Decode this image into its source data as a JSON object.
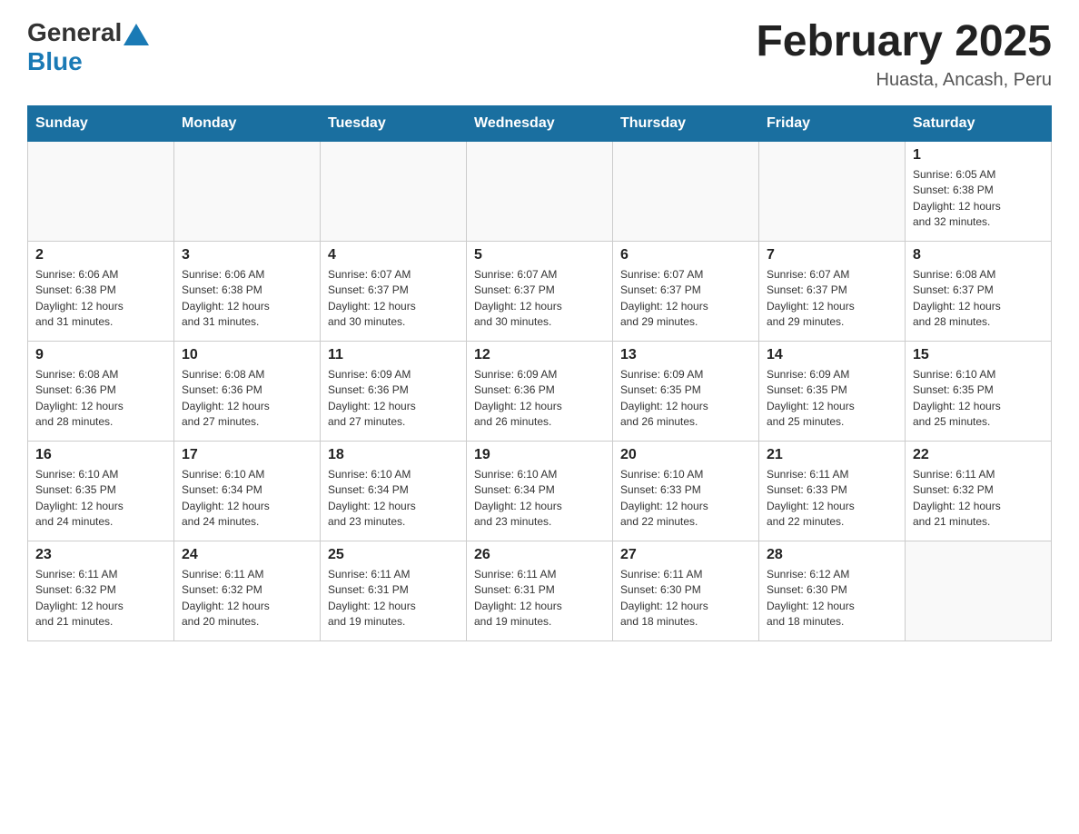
{
  "header": {
    "logo_general": "General",
    "logo_blue": "Blue",
    "title": "February 2025",
    "subtitle": "Huasta, Ancash, Peru"
  },
  "weekdays": [
    "Sunday",
    "Monday",
    "Tuesday",
    "Wednesday",
    "Thursday",
    "Friday",
    "Saturday"
  ],
  "weeks": [
    [
      {
        "day": "",
        "info": ""
      },
      {
        "day": "",
        "info": ""
      },
      {
        "day": "",
        "info": ""
      },
      {
        "day": "",
        "info": ""
      },
      {
        "day": "",
        "info": ""
      },
      {
        "day": "",
        "info": ""
      },
      {
        "day": "1",
        "info": "Sunrise: 6:05 AM\nSunset: 6:38 PM\nDaylight: 12 hours\nand 32 minutes."
      }
    ],
    [
      {
        "day": "2",
        "info": "Sunrise: 6:06 AM\nSunset: 6:38 PM\nDaylight: 12 hours\nand 31 minutes."
      },
      {
        "day": "3",
        "info": "Sunrise: 6:06 AM\nSunset: 6:38 PM\nDaylight: 12 hours\nand 31 minutes."
      },
      {
        "day": "4",
        "info": "Sunrise: 6:07 AM\nSunset: 6:37 PM\nDaylight: 12 hours\nand 30 minutes."
      },
      {
        "day": "5",
        "info": "Sunrise: 6:07 AM\nSunset: 6:37 PM\nDaylight: 12 hours\nand 30 minutes."
      },
      {
        "day": "6",
        "info": "Sunrise: 6:07 AM\nSunset: 6:37 PM\nDaylight: 12 hours\nand 29 minutes."
      },
      {
        "day": "7",
        "info": "Sunrise: 6:07 AM\nSunset: 6:37 PM\nDaylight: 12 hours\nand 29 minutes."
      },
      {
        "day": "8",
        "info": "Sunrise: 6:08 AM\nSunset: 6:37 PM\nDaylight: 12 hours\nand 28 minutes."
      }
    ],
    [
      {
        "day": "9",
        "info": "Sunrise: 6:08 AM\nSunset: 6:36 PM\nDaylight: 12 hours\nand 28 minutes."
      },
      {
        "day": "10",
        "info": "Sunrise: 6:08 AM\nSunset: 6:36 PM\nDaylight: 12 hours\nand 27 minutes."
      },
      {
        "day": "11",
        "info": "Sunrise: 6:09 AM\nSunset: 6:36 PM\nDaylight: 12 hours\nand 27 minutes."
      },
      {
        "day": "12",
        "info": "Sunrise: 6:09 AM\nSunset: 6:36 PM\nDaylight: 12 hours\nand 26 minutes."
      },
      {
        "day": "13",
        "info": "Sunrise: 6:09 AM\nSunset: 6:35 PM\nDaylight: 12 hours\nand 26 minutes."
      },
      {
        "day": "14",
        "info": "Sunrise: 6:09 AM\nSunset: 6:35 PM\nDaylight: 12 hours\nand 25 minutes."
      },
      {
        "day": "15",
        "info": "Sunrise: 6:10 AM\nSunset: 6:35 PM\nDaylight: 12 hours\nand 25 minutes."
      }
    ],
    [
      {
        "day": "16",
        "info": "Sunrise: 6:10 AM\nSunset: 6:35 PM\nDaylight: 12 hours\nand 24 minutes."
      },
      {
        "day": "17",
        "info": "Sunrise: 6:10 AM\nSunset: 6:34 PM\nDaylight: 12 hours\nand 24 minutes."
      },
      {
        "day": "18",
        "info": "Sunrise: 6:10 AM\nSunset: 6:34 PM\nDaylight: 12 hours\nand 23 minutes."
      },
      {
        "day": "19",
        "info": "Sunrise: 6:10 AM\nSunset: 6:34 PM\nDaylight: 12 hours\nand 23 minutes."
      },
      {
        "day": "20",
        "info": "Sunrise: 6:10 AM\nSunset: 6:33 PM\nDaylight: 12 hours\nand 22 minutes."
      },
      {
        "day": "21",
        "info": "Sunrise: 6:11 AM\nSunset: 6:33 PM\nDaylight: 12 hours\nand 22 minutes."
      },
      {
        "day": "22",
        "info": "Sunrise: 6:11 AM\nSunset: 6:32 PM\nDaylight: 12 hours\nand 21 minutes."
      }
    ],
    [
      {
        "day": "23",
        "info": "Sunrise: 6:11 AM\nSunset: 6:32 PM\nDaylight: 12 hours\nand 21 minutes."
      },
      {
        "day": "24",
        "info": "Sunrise: 6:11 AM\nSunset: 6:32 PM\nDaylight: 12 hours\nand 20 minutes."
      },
      {
        "day": "25",
        "info": "Sunrise: 6:11 AM\nSunset: 6:31 PM\nDaylight: 12 hours\nand 19 minutes."
      },
      {
        "day": "26",
        "info": "Sunrise: 6:11 AM\nSunset: 6:31 PM\nDaylight: 12 hours\nand 19 minutes."
      },
      {
        "day": "27",
        "info": "Sunrise: 6:11 AM\nSunset: 6:30 PM\nDaylight: 12 hours\nand 18 minutes."
      },
      {
        "day": "28",
        "info": "Sunrise: 6:12 AM\nSunset: 6:30 PM\nDaylight: 12 hours\nand 18 minutes."
      },
      {
        "day": "",
        "info": ""
      }
    ]
  ]
}
